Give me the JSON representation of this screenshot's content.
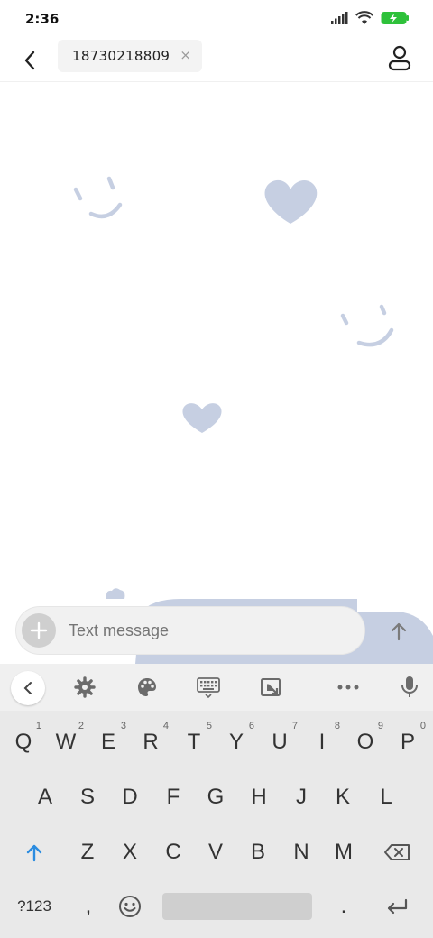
{
  "status_bar": {
    "time": "2:36",
    "battery_color": "#2ec13a"
  },
  "header": {
    "recipient": "18730218809",
    "clear_glyph": "×"
  },
  "composer": {
    "placeholder": "Text message"
  },
  "theme": {
    "wallpaper_accent": "#c6cfe2"
  },
  "keyboard": {
    "row1": [
      {
        "label": "Q",
        "hint": "1"
      },
      {
        "label": "W",
        "hint": "2"
      },
      {
        "label": "E",
        "hint": "3"
      },
      {
        "label": "R",
        "hint": "4"
      },
      {
        "label": "T",
        "hint": "5"
      },
      {
        "label": "Y",
        "hint": "6"
      },
      {
        "label": "U",
        "hint": "7"
      },
      {
        "label": "I",
        "hint": "8"
      },
      {
        "label": "O",
        "hint": "9"
      },
      {
        "label": "P",
        "hint": "0"
      }
    ],
    "row2": [
      "A",
      "S",
      "D",
      "F",
      "G",
      "H",
      "J",
      "K",
      "L"
    ],
    "row3": [
      "Z",
      "X",
      "C",
      "V",
      "B",
      "N",
      "M"
    ],
    "symbols_label": "?123",
    "comma": ",",
    "period": ".",
    "toolbar_icons": [
      "collapse-icon",
      "settings-icon",
      "theme-palette-icon",
      "keyboard-layout-icon",
      "resize-icon",
      "more-icon",
      "microphone-icon"
    ]
  }
}
